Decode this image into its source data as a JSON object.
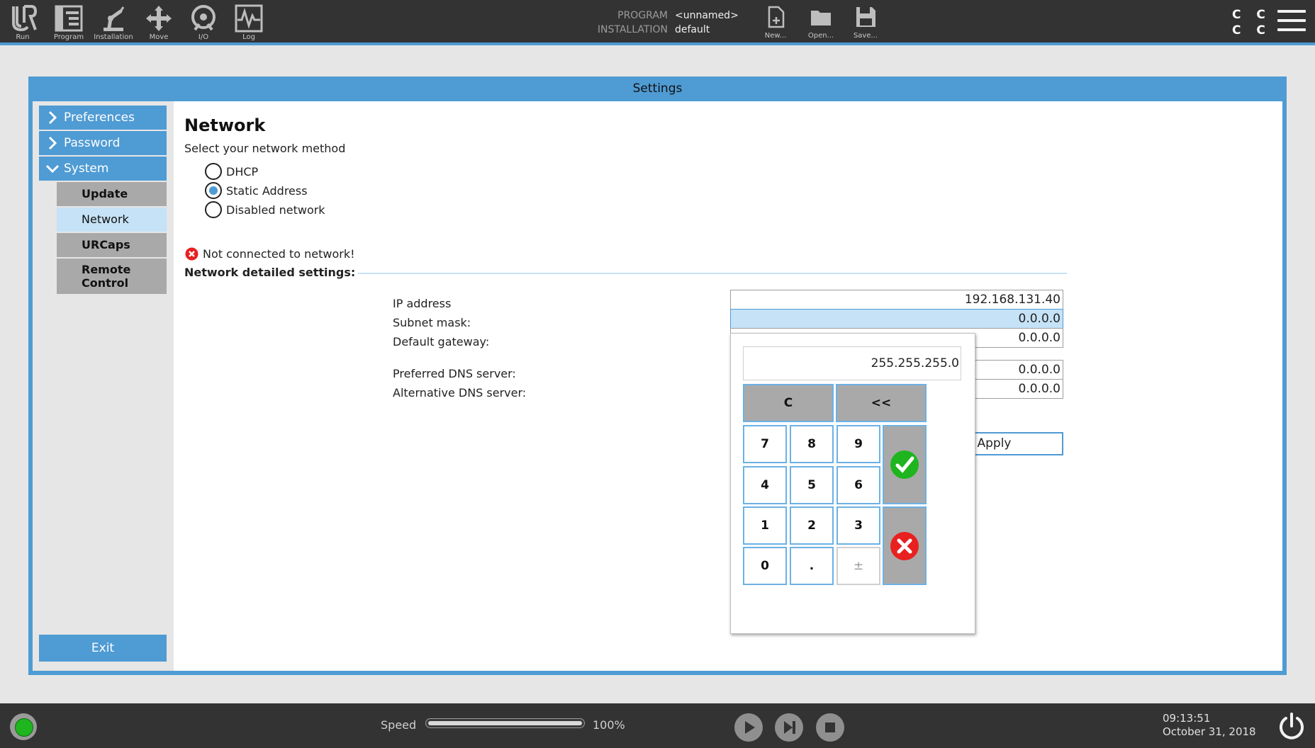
{
  "topbar": {
    "nav": [
      {
        "label": "Run",
        "icon": "ur-logo-icon"
      },
      {
        "label": "Program",
        "icon": "program-icon"
      },
      {
        "label": "Installation",
        "icon": "installation-icon"
      },
      {
        "label": "Move",
        "icon": "move-icon"
      },
      {
        "label": "I/O",
        "icon": "io-icon"
      },
      {
        "label": "Log",
        "icon": "log-icon"
      }
    ],
    "program_key": "PROGRAM",
    "program_value": "<unnamed>",
    "installation_key": "INSTALLATION",
    "installation_value": "default",
    "file_buttons": [
      {
        "label": "New...",
        "icon": "new-file-icon"
      },
      {
        "label": "Open...",
        "icon": "open-folder-icon"
      },
      {
        "label": "Save...",
        "icon": "save-disk-icon"
      }
    ],
    "cc_indicator": [
      "C C",
      "C C"
    ],
    "menu_icon": "hamburger-menu-icon"
  },
  "window": {
    "title": "Settings"
  },
  "sidebar": {
    "main_items": [
      {
        "label": "Preferences",
        "expanded": false
      },
      {
        "label": "Password",
        "expanded": false
      },
      {
        "label": "System",
        "expanded": true
      }
    ],
    "sub_items": [
      {
        "label": "Update",
        "active": false
      },
      {
        "label": "Network",
        "active": true
      },
      {
        "label": "URCaps",
        "active": false
      },
      {
        "label": "Remote Control",
        "active": false
      }
    ],
    "exit_label": "Exit"
  },
  "network": {
    "title": "Network",
    "subtitle": "Select your network method",
    "methods": [
      {
        "label": "DHCP",
        "selected": false
      },
      {
        "label": "Static Address",
        "selected": true
      },
      {
        "label": "Disabled network",
        "selected": false
      }
    ],
    "status_text": "Not connected to network!",
    "detail_header": "Network detailed settings:",
    "fields": [
      {
        "label": "IP address",
        "value": "192.168.131.40"
      },
      {
        "label": "Subnet mask:",
        "value": "0.0.0.0"
      },
      {
        "label": "Default gateway:",
        "value": "0.0.0.0"
      },
      {
        "label": "Preferred DNS server:",
        "value": "0.0.0.0"
      },
      {
        "label": "Alternative DNS server:",
        "value": "0.0.0.0"
      }
    ],
    "apply_label": "Apply"
  },
  "keypad": {
    "display_value": "255.255.255.0",
    "clear_label": "C",
    "backspace_label": "<<",
    "digits": [
      "7",
      "8",
      "9",
      "4",
      "5",
      "6",
      "1",
      "2",
      "3",
      "0",
      ".",
      "±"
    ],
    "ok_icon": "checkmark-icon",
    "cancel_icon": "cancel-x-icon",
    "ok_color": "#1fb51f",
    "cancel_color": "#e8201f"
  },
  "bottombar": {
    "speed_label": "Speed",
    "speed_value": "100%",
    "speed_fraction": 1.0,
    "time": "09:13:51",
    "date": "October 31, 2018"
  },
  "colors": {
    "accent": "#4f9bd4",
    "accent_light": "#c5e2f7",
    "bar_bg": "#333333",
    "sub_item_bg": "#a9a9a9"
  }
}
